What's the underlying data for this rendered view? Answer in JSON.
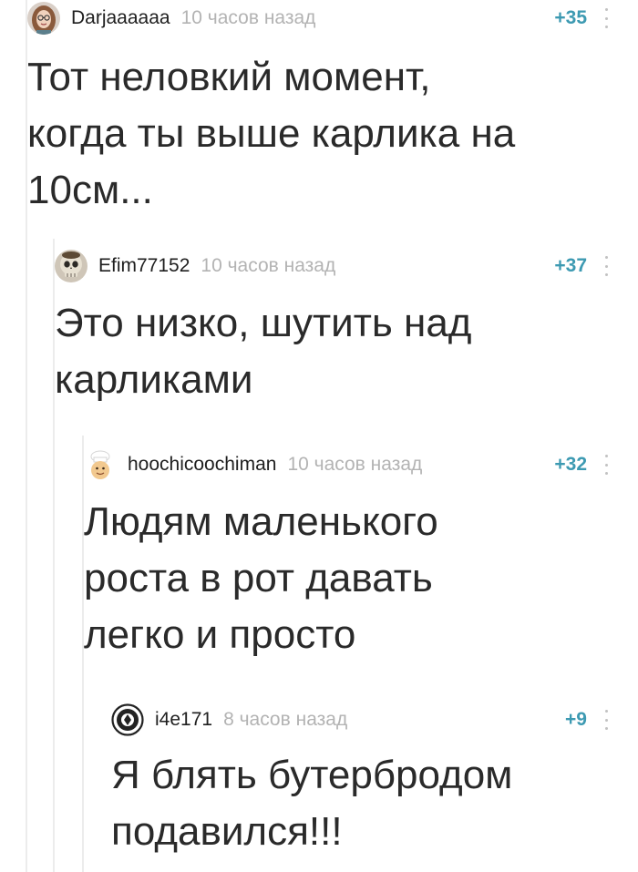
{
  "comments": [
    {
      "author": "Darjaaaaaa",
      "time": "10 часов назад",
      "rating": "+35",
      "text": "Тот неловкий момент,\nкогда ты выше карлика на\n10см..."
    },
    {
      "author": "Efim77152",
      "time": "10 часов назад",
      "rating": "+37",
      "text": "Это низко, шутить над\nкарликами"
    },
    {
      "author": "hoochicoochiman",
      "time": "10 часов назад",
      "rating": "+32",
      "text": "Людям маленького\nроста в рот давать\nлегко и просто"
    },
    {
      "author": "i4e171",
      "time": "8 часов назад",
      "rating": "+9",
      "text": "Я блять бутербродом\nподавился!!!"
    }
  ],
  "colors": {
    "rating": "#3d9ab2",
    "time": "#b3b3b3",
    "thread_line": "#ececec",
    "text": "#2a2a2a"
  },
  "icons": [
    "avatar-woman-icon",
    "avatar-skull-icon",
    "avatar-chef-icon",
    "avatar-badge-icon",
    "more-menu-icon"
  ]
}
